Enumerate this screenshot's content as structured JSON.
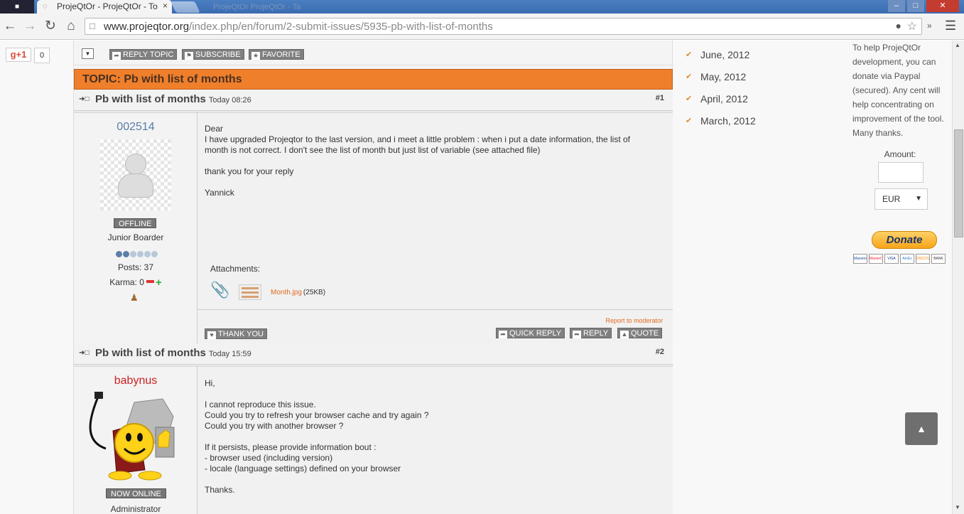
{
  "browser": {
    "tab_title": "ProjeQtOr - ProjeQtOr - To",
    "tab_ghost": "ProjeQtOr ProjeQtOr - Ta",
    "url_domain": "www.projeqtor.org",
    "url_path": "/index.php/en/forum/2-submit-issues/5935-pb-with-list-of-months",
    "icons": {
      "back": "back-arrow-icon",
      "forward": "forward-arrow-icon",
      "reload": "reload-icon",
      "home": "home-icon",
      "menu": "hamburger-menu-icon"
    }
  },
  "social": {
    "gplus_label": "g+1",
    "gplus_count": "0"
  },
  "forum": {
    "actions": {
      "reply_topic": "REPLY TOPIC",
      "subscribe": "SUBSCRIBE",
      "favorite": "FAVORITE"
    },
    "topic_title": "TOPIC: Pb with list of months",
    "posts": [
      {
        "title": "Pb with list of months",
        "time": "Today 08:26",
        "number": "#1",
        "author": "002514",
        "author_color": "#5a7ea8",
        "status": "OFFLINE",
        "rank": "Junior Boarder",
        "rank_level": 2,
        "posts": "Posts: 37",
        "karma": "Karma: 0",
        "text": "Dear\nI have upgraded Projeqtor to the last version, and i meet a little problem : when i put a date information, the list of\nmonth is not correct. I don't see the list of month but just list of variable (see attached file)\n\nthank you for your reply\n\nYannick",
        "attachments_label": "Attachments:",
        "attachment_file": "Month.jpg",
        "attachment_size": "(25KB)",
        "report": "Report to moderator",
        "thank_you": "THANK YOU",
        "quick_reply": "QUICK REPLY",
        "reply": "REPLY",
        "quote": "QUOTE"
      },
      {
        "title": "Pb with list of months",
        "time": "Today 15:59",
        "number": "#2",
        "author": "babynus",
        "author_color": "#cc2222",
        "status": "NOW ONLINE",
        "rank": "Administrator",
        "text": "Hi,\n\nI cannot reproduce this issue.\nCould you try to refresh your browser cache and try again ?\nCould you try with another browser ?\n\nIf it persists, please provide information bout :\n- browser used (including version)\n- locale (language settings) defined on your browser\n\nThanks."
      }
    ]
  },
  "sidebar": {
    "months": [
      "June, 2012",
      "May, 2012",
      "April, 2012",
      "March, 2012"
    ],
    "donate_text": "To help ProjeQtOr development, you can donate via Paypal (secured). Any cent will help concentrating on improvement of the tool. Many thanks.",
    "amount_label": "Amount:",
    "currency": "EUR",
    "donate_button": "Donate",
    "cards": [
      "Maestro",
      "MasterCard",
      "VISA",
      "AmEx",
      "DISCOVER",
      "BANK"
    ]
  },
  "colors": {
    "topic_bar": "#ef7f2a",
    "accent_link": "#e06a20"
  }
}
